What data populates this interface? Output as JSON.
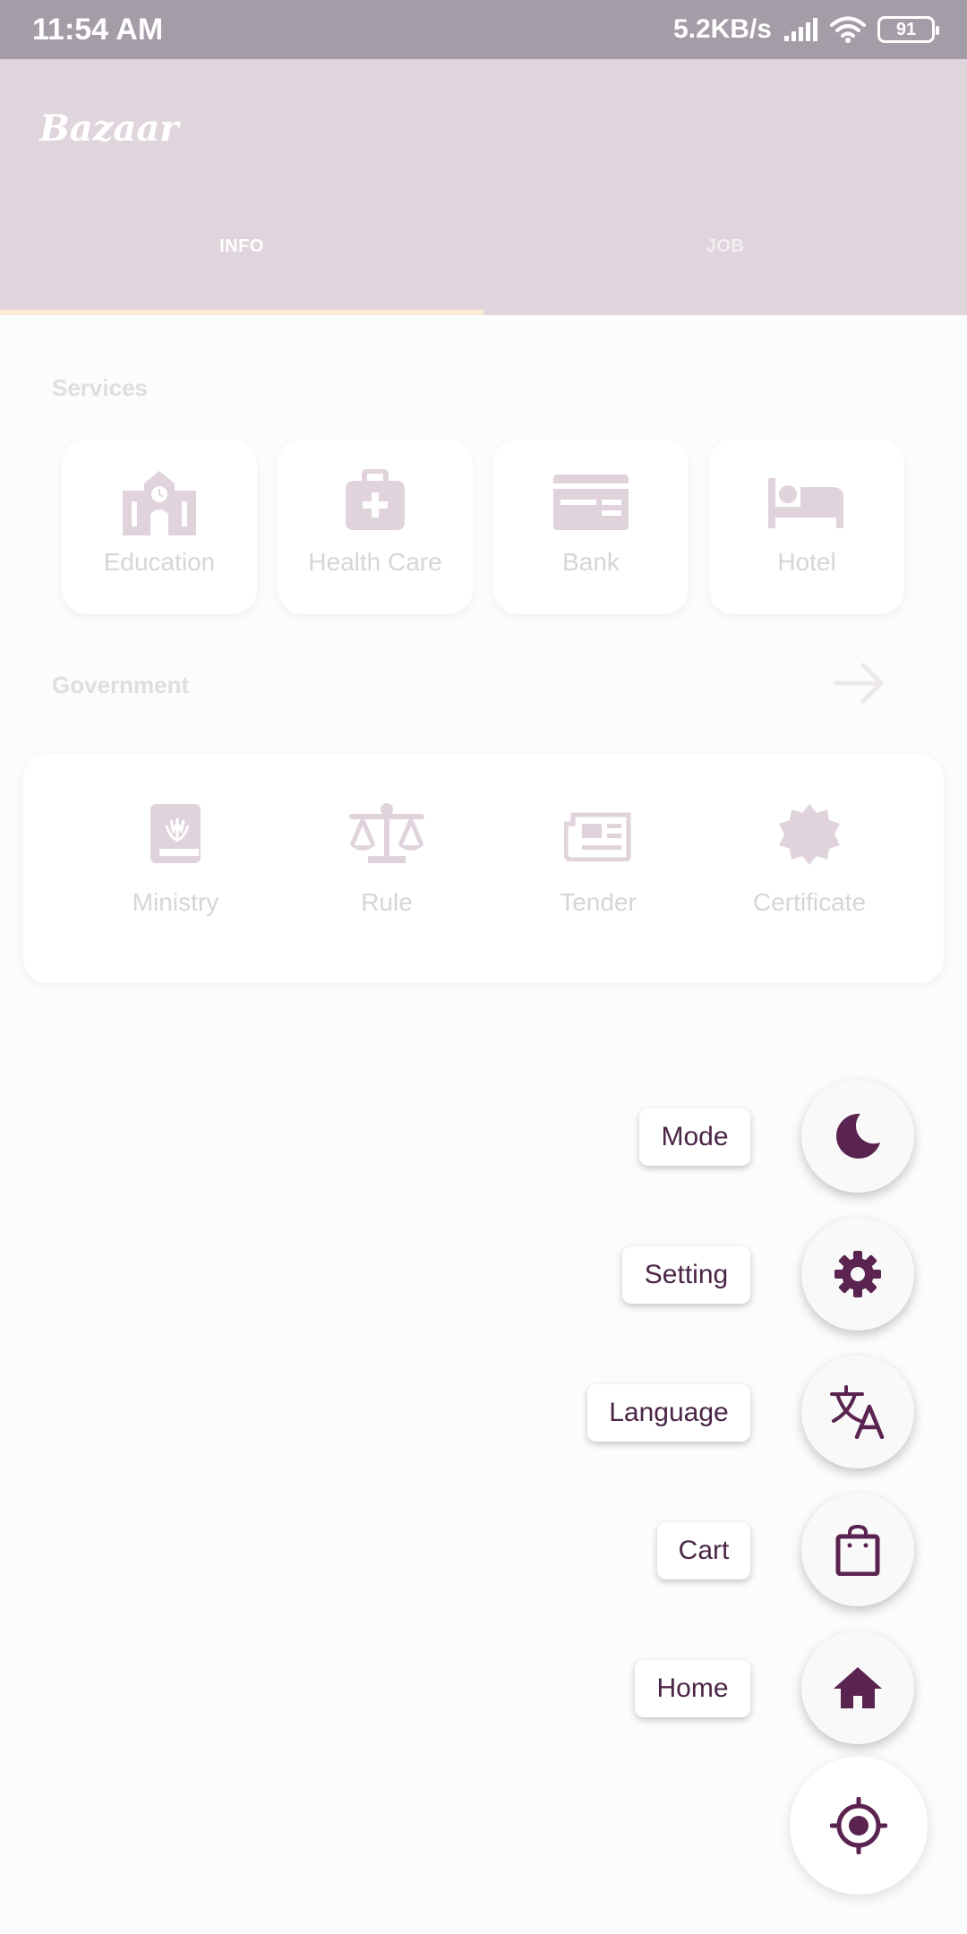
{
  "status_bar": {
    "time": "11:54 AM",
    "network_speed": "5.2KB/s",
    "battery": "91",
    "icons": [
      "signal-icon",
      "wifi-icon",
      "battery-icon"
    ]
  },
  "app_bar": {
    "logo": "Bazaar",
    "tabs": [
      {
        "label": "INFO",
        "selected": true
      },
      {
        "label": "JOB",
        "selected": false
      }
    ]
  },
  "services": {
    "title": "Services",
    "items": [
      {
        "label": "Education",
        "icon": "school-icon"
      },
      {
        "label": "Health Care",
        "icon": "medical-bag-icon"
      },
      {
        "label": "Bank",
        "icon": "card-icon"
      },
      {
        "label": "Hotel",
        "icon": "bed-icon"
      }
    ]
  },
  "government": {
    "title": "Government",
    "more_icon": "arrow-right-icon",
    "items": [
      {
        "label": "Ministry",
        "icon": "book-emblem-icon"
      },
      {
        "label": "Rule",
        "icon": "scale-icon"
      },
      {
        "label": "Tender",
        "icon": "newspaper-icon"
      },
      {
        "label": "Certificate",
        "icon": "badge-icon"
      }
    ]
  },
  "speed_dial": {
    "items": [
      {
        "label": "Mode",
        "icon": "moon-icon"
      },
      {
        "label": "Setting",
        "icon": "gear-icon"
      },
      {
        "label": "Language",
        "icon": "translate-icon"
      },
      {
        "label": "Cart",
        "icon": "shopping-bag-icon"
      },
      {
        "label": "Home",
        "icon": "home-icon"
      }
    ],
    "main_icon": "location-target-icon"
  },
  "colors": {
    "app_bar": "#e0d5dc",
    "status_bar": "#a49ca6",
    "tab_indicator": "#fce9d6",
    "faded_icon": "#e0d3dc",
    "accent": "#5a2350",
    "background": "#fbfcfc"
  }
}
